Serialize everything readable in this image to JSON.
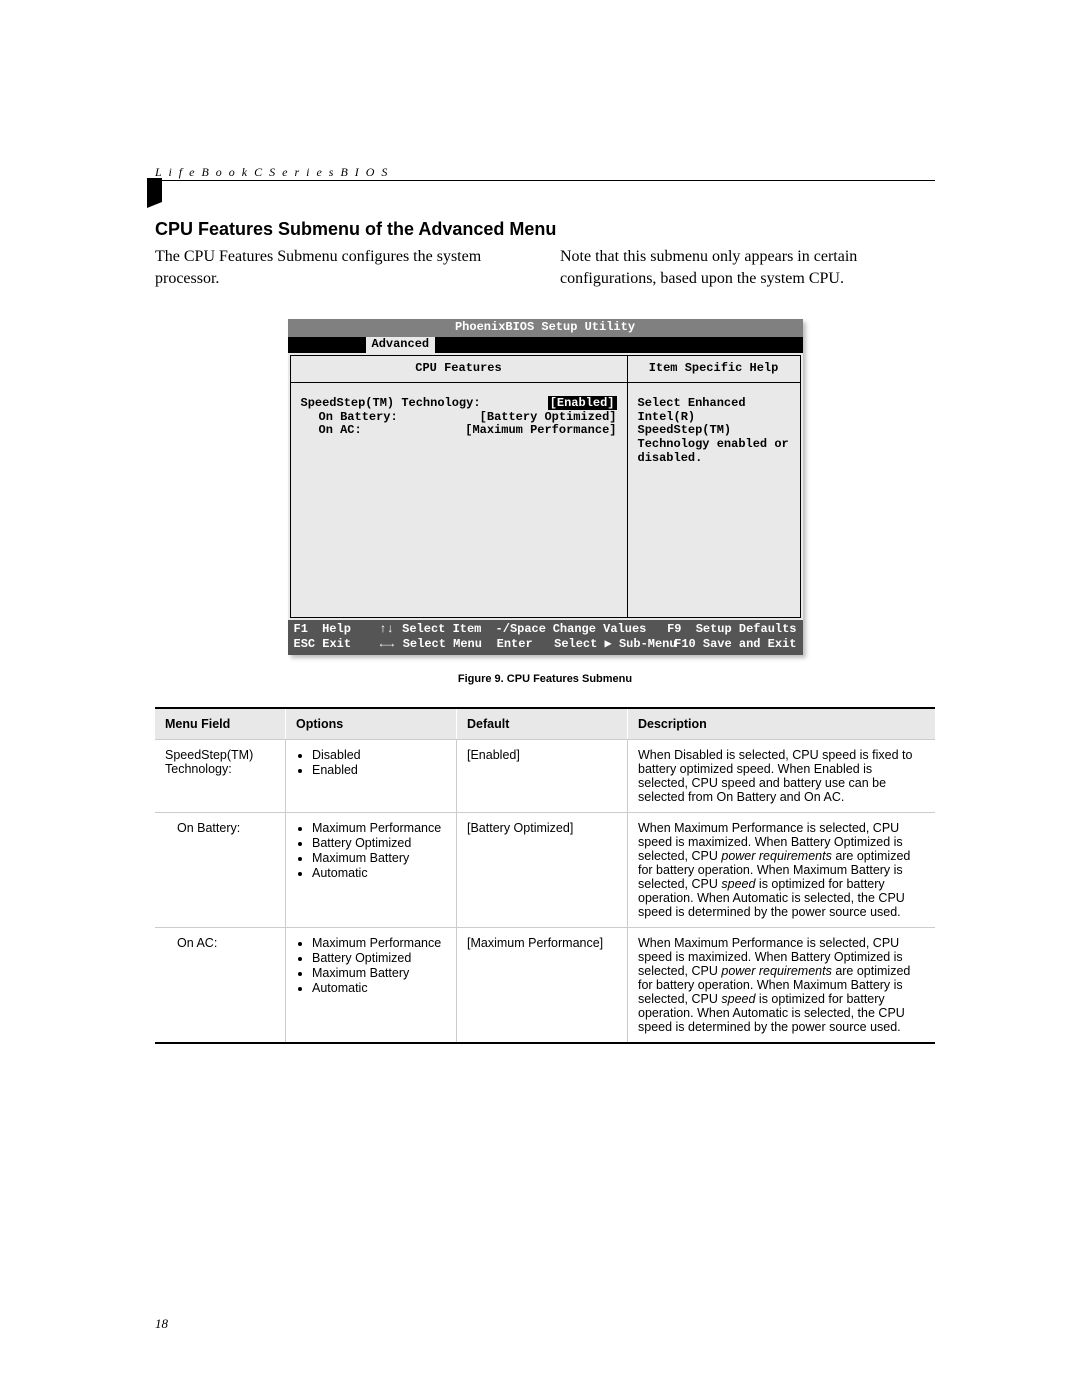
{
  "running_header": "L i f e B o o k   C   S e r i e s   B I O S",
  "section_title": "CPU Features Submenu of the Advanced Menu",
  "intro_left": "The CPU Features Submenu configures the system processor.",
  "intro_right": "Note that this submenu only appears in certain configurations, based upon the system CPU.",
  "bios": {
    "title": "PhoenixBIOS Setup Utility",
    "active_tab": "Advanced",
    "left_title": "CPU Features",
    "right_title": "Item Specific Help",
    "help_text": "Select Enhanced Intel(R) SpeedStep(TM) Technology enabled or disabled.",
    "settings": [
      {
        "label": "SpeedStep(TM) Technology:",
        "indent": false,
        "value": "[Enabled]",
        "highlight": true
      },
      {
        "label": "On Battery:",
        "indent": true,
        "value": "[Battery Optimized]",
        "highlight": false
      },
      {
        "label": "On AC:",
        "indent": true,
        "value": "[Maximum Performance]",
        "highlight": false
      }
    ],
    "keys": {
      "row1": [
        {
          "k": "F1",
          "t": "Help"
        },
        {
          "k": "↑↓",
          "t": "Select Item"
        },
        {
          "k": "-/Space",
          "t": "Change Values"
        },
        {
          "k": "F9",
          "t": "Setup Defaults"
        }
      ],
      "row2": [
        {
          "k": "ESC",
          "t": "Exit"
        },
        {
          "k": "←→",
          "t": "Select Menu"
        },
        {
          "k": "Enter",
          "t": "Select ▶ Sub-Menu"
        },
        {
          "k": "F10",
          "t": "Save and Exit"
        }
      ]
    }
  },
  "figure_caption": "Figure 9.  CPU Features Submenu",
  "table": {
    "headers": [
      "Menu Field",
      "Options",
      "Default",
      "Description"
    ],
    "rows": [
      {
        "menu": "SpeedStep(TM) Technology:",
        "indent": false,
        "options": [
          "Disabled",
          "Enabled"
        ],
        "default": "[Enabled]",
        "desc_plain": "When Disabled is selected, CPU speed is fixed to battery optimized speed. When Enabled is selected, CPU speed and battery use can be selected from On Battery and On AC."
      },
      {
        "menu": "On Battery:",
        "indent": true,
        "options": [
          "Maximum Performance",
          "Battery Optimized",
          "Maximum Battery",
          "Automatic"
        ],
        "default": "[Battery Optimized]",
        "desc_segments": [
          {
            "t": "When Maximum Performance is selected, CPU speed is maximized. When Battery Optimized is selected, CPU ",
            "i": false
          },
          {
            "t": "power requirements",
            "i": true
          },
          {
            "t": " are optimized for battery operation. When Maximum Battery is selected, CPU ",
            "i": false
          },
          {
            "t": "speed",
            "i": true
          },
          {
            "t": " is optimized for battery operation. When Automatic is selected, the CPU speed is determined by the power source used.",
            "i": false
          }
        ]
      },
      {
        "menu": "On AC:",
        "indent": true,
        "options": [
          "Maximum Performance",
          "Battery Optimized",
          "Maximum Battery",
          "Automatic"
        ],
        "default": "[Maximum Performance]",
        "desc_segments": [
          {
            "t": "When Maximum Performance is selected, CPU speed is maximized. When Battery Optimized is selected, CPU ",
            "i": false
          },
          {
            "t": "power requirements",
            "i": true
          },
          {
            "t": " are optimized for battery operation. When Maximum Battery is selected, CPU ",
            "i": false
          },
          {
            "t": "speed",
            "i": true
          },
          {
            "t": " is optimized for battery operation. When Automatic is selected, the CPU speed is determined by the power source used.",
            "i": false
          }
        ]
      }
    ]
  },
  "page_number": "18"
}
